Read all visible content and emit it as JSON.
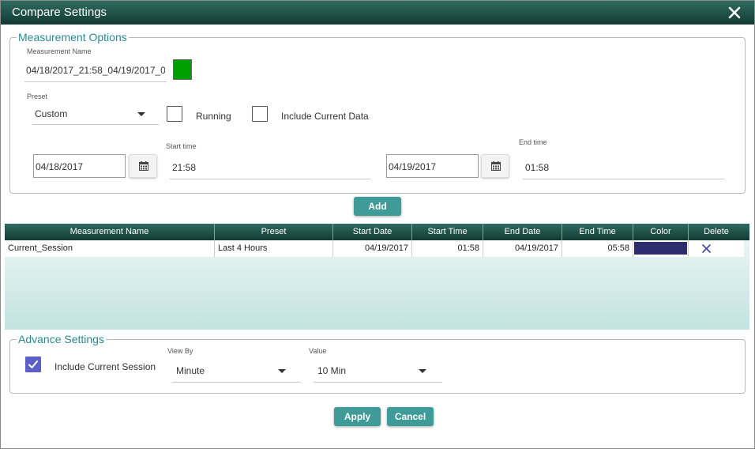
{
  "dialog": {
    "title": "Compare Settings",
    "close_icon": "close-icon"
  },
  "measurement_options": {
    "legend": "Measurement Options",
    "name_label": "Measurement Name",
    "name_value": "04/18/2017_21:58_04/19/2017_0",
    "name_color": "#00a000",
    "preset_label": "Preset",
    "preset_value": "Custom",
    "running_label": "Running",
    "running_checked": false,
    "include_current_label": "Include Current Data",
    "include_current_checked": false,
    "start_date": "04/18/2017",
    "start_time_label": "Start time",
    "start_time": "21:58",
    "end_date": "04/19/2017",
    "end_time_label": "End time",
    "end_time": "01:58"
  },
  "add_button": "Add",
  "table": {
    "columns": [
      "Measurement Name",
      "Preset",
      "Start Date",
      "Start Time",
      "End Date",
      "End Time",
      "Color",
      "Delete"
    ],
    "rows": [
      {
        "measurement_name": "Current_Session",
        "preset": "Last 4 Hours",
        "start_date": "04/19/2017",
        "start_time": "01:58",
        "end_date": "04/19/2017",
        "end_time": "05:58",
        "color": "#2d2d6e",
        "delete_icon": "delete-x-icon"
      }
    ]
  },
  "advance_settings": {
    "legend": "Advance Settings",
    "include_session_label": "Include Current Session",
    "include_session_checked": true,
    "view_by_label": "View By",
    "view_by_value": "Minute",
    "value_label": "Value",
    "value_value": "10 Min"
  },
  "footer": {
    "apply": "Apply",
    "cancel": "Cancel"
  },
  "colors": {
    "header_dark": "#123a34",
    "accent": "#3e9b98",
    "legend": "#2a8a92",
    "checkbox": "#5b5fc7"
  }
}
